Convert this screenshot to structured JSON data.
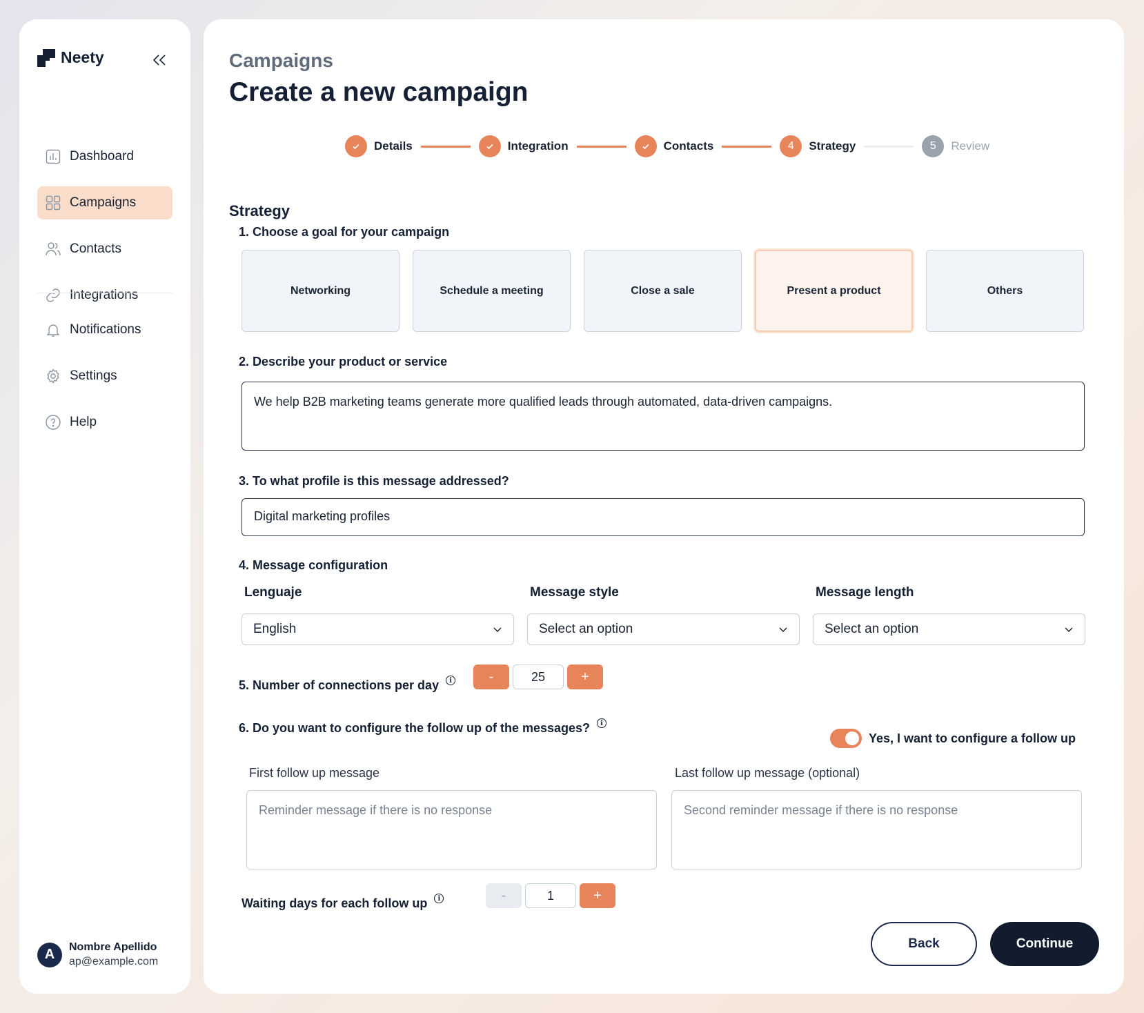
{
  "brand": {
    "name": "Neety"
  },
  "sidebar": {
    "items": [
      {
        "label": "Dashboard",
        "icon": "dashboard-icon"
      },
      {
        "label": "Campaigns",
        "icon": "grid-icon",
        "active": true
      },
      {
        "label": "Contacts",
        "icon": "users-icon"
      },
      {
        "label": "Integrations",
        "icon": "link-icon"
      }
    ],
    "secondary": [
      {
        "label": "Notifications",
        "icon": "bell-icon"
      },
      {
        "label": "Settings",
        "icon": "gear-icon"
      },
      {
        "label": "Help",
        "icon": "help-icon"
      }
    ],
    "user": {
      "initial": "A",
      "name": "Nombre Apellido",
      "email": "ap@example.com"
    }
  },
  "header": {
    "breadcrumb": "Campaigns",
    "title": "Create a new campaign"
  },
  "stepper": {
    "steps": [
      {
        "label": "Details",
        "status": "done"
      },
      {
        "label": "Integration",
        "status": "done"
      },
      {
        "label": "Contacts",
        "status": "done"
      },
      {
        "label": "Strategy",
        "status": "current",
        "number": "4"
      },
      {
        "label": "Review",
        "status": "pending",
        "number": "5"
      }
    ]
  },
  "strategy": {
    "title": "Strategy",
    "q1": {
      "number": "1.",
      "label": "Choose a goal for your campaign",
      "options": [
        "Networking",
        "Schedule a meeting",
        "Close a sale",
        "Present a product",
        "Others"
      ],
      "selected": "Present a product"
    },
    "q2": {
      "number": "2.",
      "label": "Describe your product or service",
      "value": "We help B2B marketing teams generate more qualified leads through automated, data-driven campaigns."
    },
    "q3": {
      "number": "3.",
      "label": "To what profile is this message addressed?",
      "value": "Digital marketing profiles"
    },
    "q4": {
      "number": "4.",
      "label": "Message configuration",
      "language": {
        "label": "Lenguaje",
        "value": "English"
      },
      "style": {
        "label": "Message style",
        "value": "Select an option"
      },
      "length": {
        "label": "Message length",
        "value": "Select an option"
      }
    },
    "q5": {
      "number": "5.",
      "label": "Number of connections per day",
      "value": "25",
      "minus": "-",
      "plus": "+"
    },
    "q6": {
      "number": "6.",
      "label": "Do you want to configure the follow up of the messages?",
      "toggle_label": "Yes, I want to configure a follow up",
      "toggle_on": true,
      "first": {
        "label": "First follow up message",
        "placeholder": "Reminder message if there is no response"
      },
      "last": {
        "label": "Last follow up message (optional)",
        "placeholder": "Second reminder message if there is no response"
      },
      "waiting": {
        "label": "Waiting days for each follow up",
        "value": "1",
        "minus": "-",
        "plus": "+"
      }
    }
  },
  "footer": {
    "back": "Back",
    "continue": "Continue"
  },
  "colors": {
    "accent": "#e8845a",
    "dark": "#121c2e",
    "active_nav": "#fadccb"
  }
}
